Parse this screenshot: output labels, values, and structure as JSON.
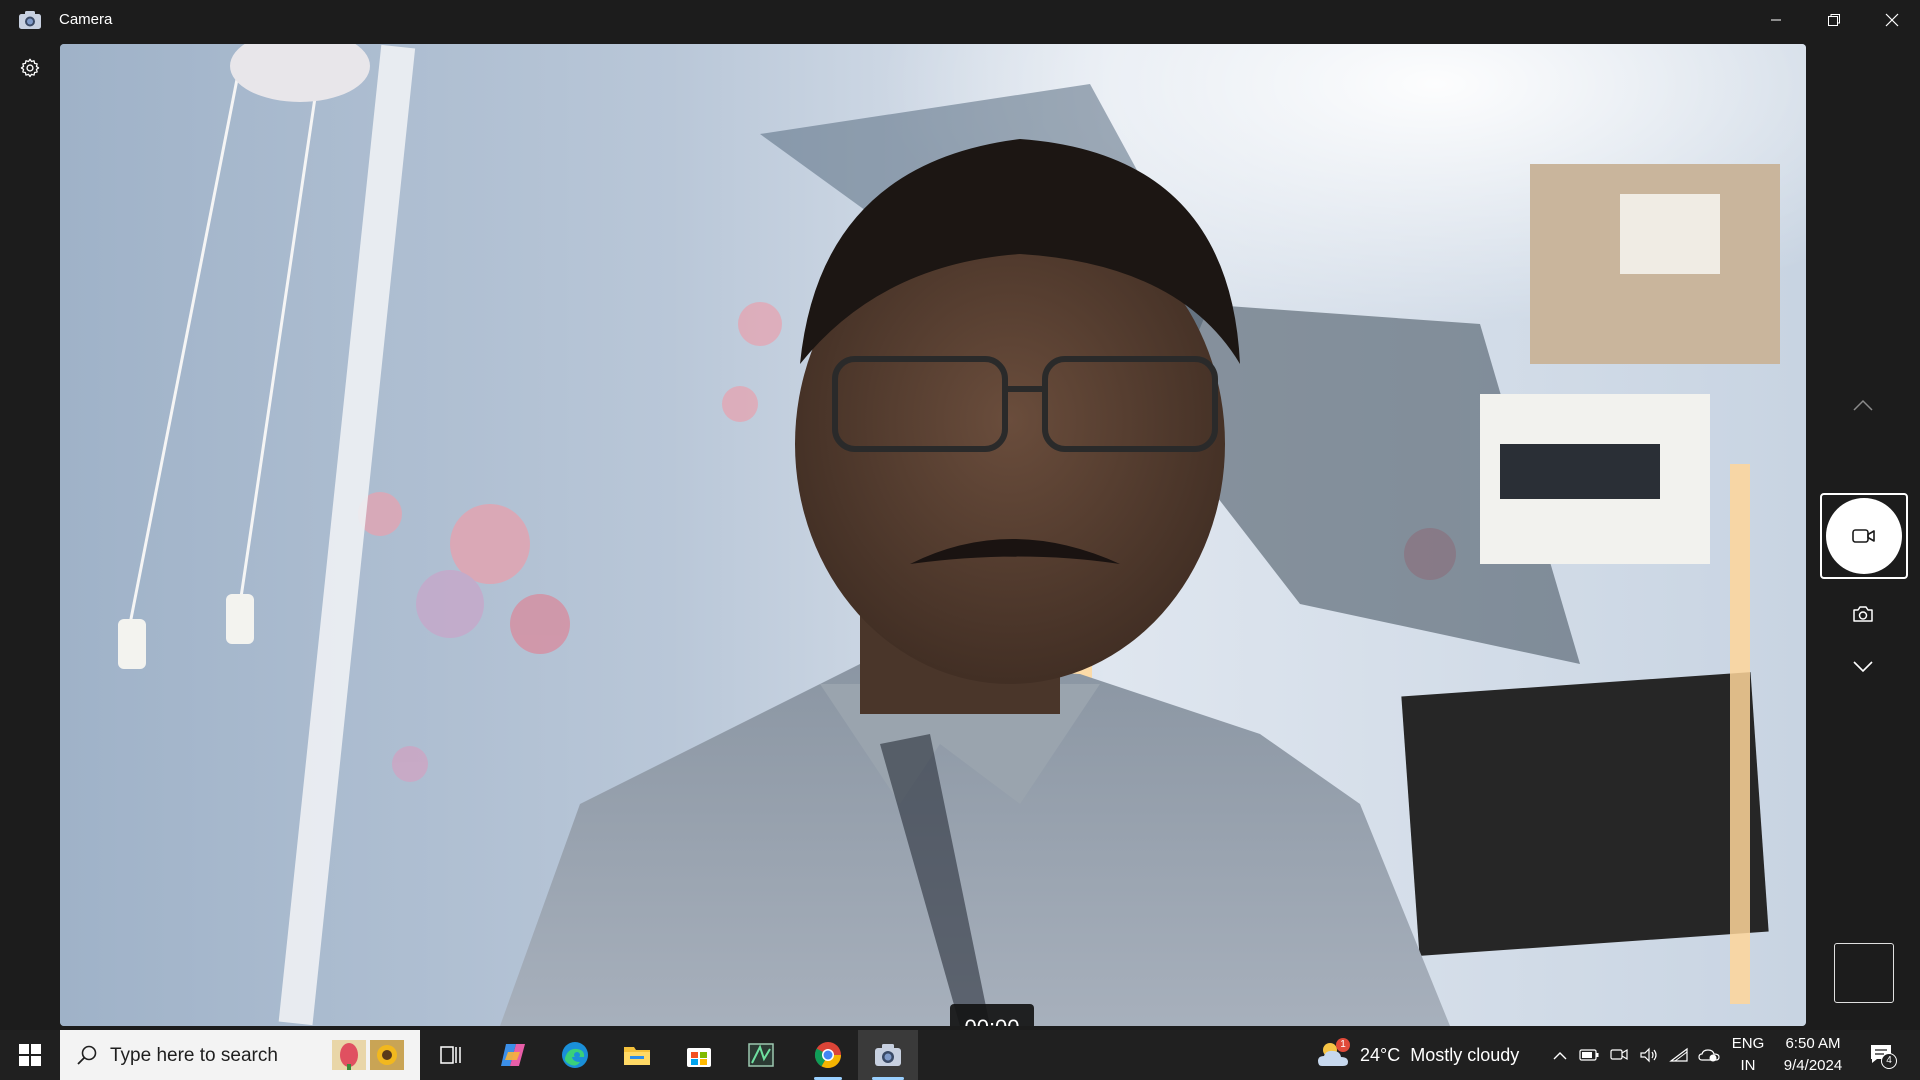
{
  "window": {
    "title": "Camera",
    "minimize_label": "",
    "maximize_label": "",
    "close_label": ""
  },
  "camera": {
    "timer": "00:00",
    "mode": "video"
  },
  "taskbar": {
    "search_placeholder": "Type here to search",
    "weather": {
      "temperature": "24°C",
      "condition": "Mostly cloudy",
      "badge": "1"
    },
    "language": {
      "line1": "ENG",
      "line2": "IN"
    },
    "clock": {
      "time": "6:50 AM",
      "date": "9/4/2024"
    },
    "notifications_count": "4",
    "pinned_apps": [
      "task-view",
      "copilot",
      "edge",
      "file-explorer",
      "microsoft-store",
      "app-green",
      "chrome",
      "camera"
    ]
  },
  "colors": {
    "titlebar_bg": "#1c1c1c",
    "taskbar_bg": "#202020",
    "search_bg": "#f3f3f3",
    "active_indicator": "#9ad0ff"
  }
}
